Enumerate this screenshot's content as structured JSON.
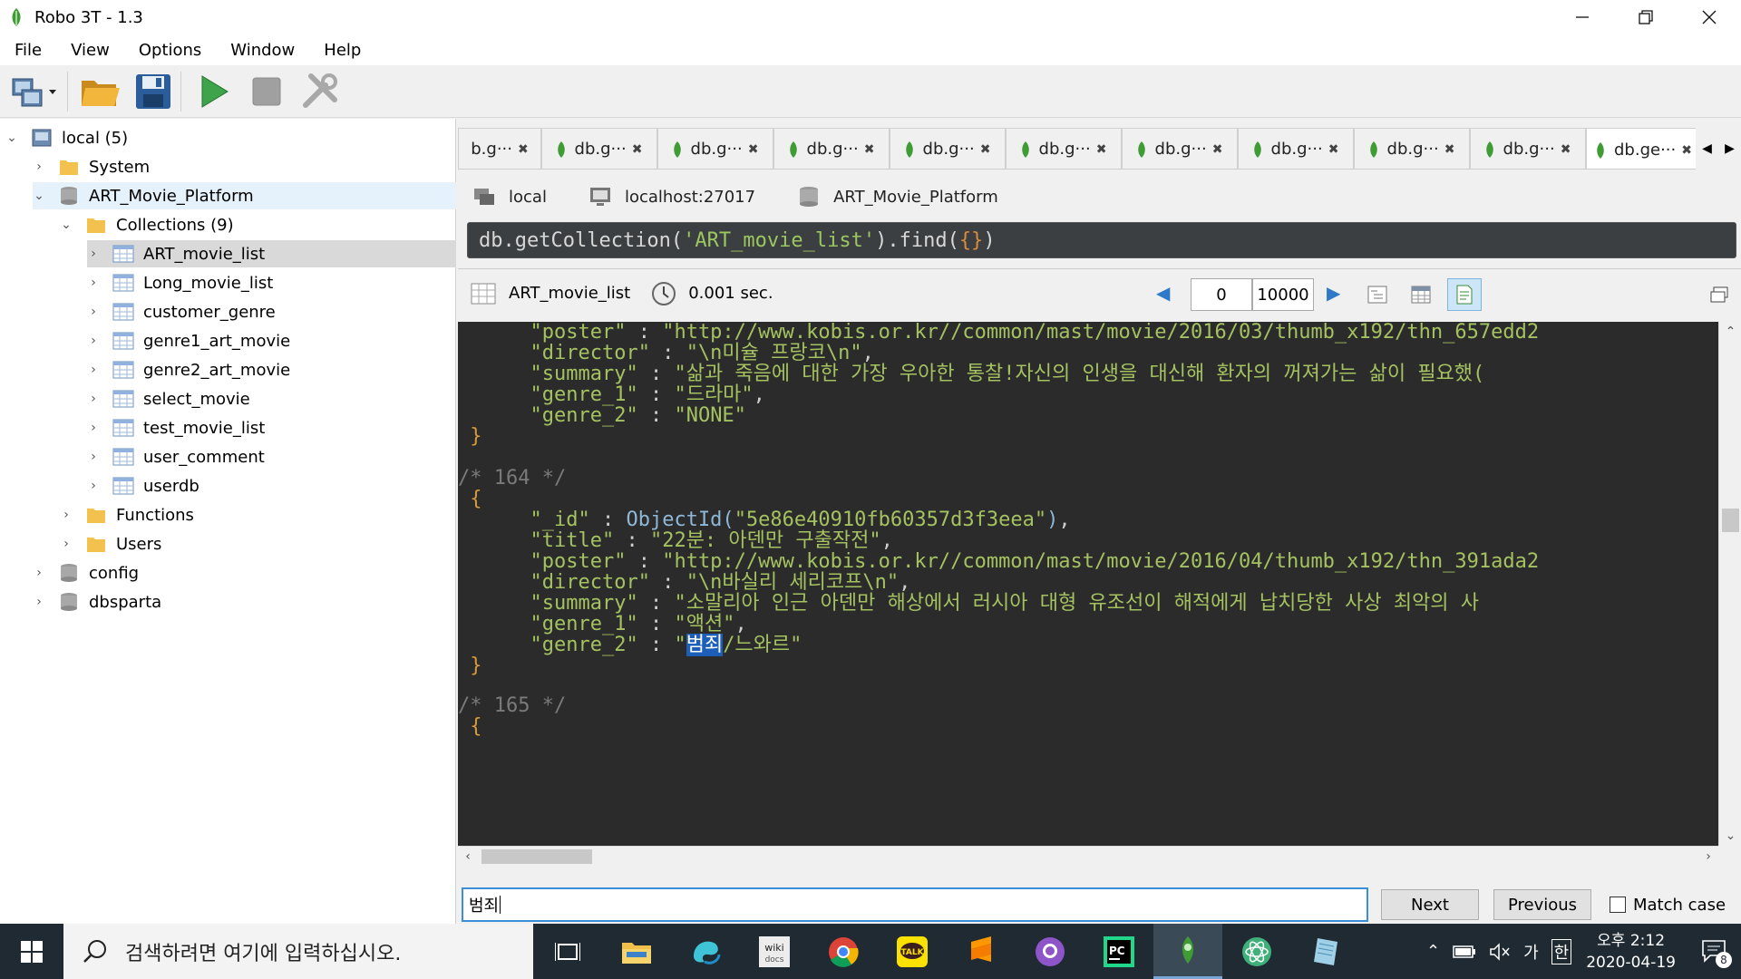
{
  "window": {
    "title": "Robo 3T - 1.3"
  },
  "menu": [
    "File",
    "View",
    "Options",
    "Window",
    "Help"
  ],
  "tree": {
    "root": "local (5)",
    "system": "System",
    "db": "ART_Movie_Platform",
    "collections_label": "Collections (9)",
    "collections": [
      "ART_movie_list",
      "Long_movie_list",
      "customer_genre",
      "genre1_art_movie",
      "genre2_art_movie",
      "select_movie",
      "test_movie_list",
      "user_comment",
      "userdb"
    ],
    "functions": "Functions",
    "users": "Users",
    "other_dbs": [
      "config",
      "dbsparta"
    ]
  },
  "tabs": {
    "first_partial": "b.g···",
    "items": [
      "db.g···",
      "db.g···",
      "db.g···",
      "db.g···",
      "db.g···",
      "db.g···",
      "db.g···",
      "db.g···",
      "db.g···"
    ],
    "active": "db.ge···"
  },
  "connection": {
    "server": "local",
    "host": "localhost:27017",
    "database": "ART_Movie_Platform"
  },
  "query": {
    "prefix": "db.getCollection(",
    "collection": "'ART_movie_list'",
    "suffix": ").find(",
    "braces": "{}",
    "end": ")"
  },
  "result": {
    "collection": "ART_movie_list",
    "time": "0.001 sec.",
    "skip": "0",
    "limit": "10000"
  },
  "code": {
    "rec163": {
      "poster": "\"http://www.kobis.or.kr//common/mast/movie/2016/03/thumb_x192/thn_657edd2",
      "director": "\"\\n미슐 프랑코\\n\"",
      "summary": "\"삶과 죽음에 대한 가장 우아한 통찰!자신의 인생을 대신해 환자의 꺼져가는 삶이 필요했(",
      "genre_1": "\"드라마\"",
      "genre_2": "\"NONE\""
    },
    "comment164": "/* 164 */",
    "rec164": {
      "id_fn": "ObjectId(",
      "id_val": "\"5e86e40910fb60357d3f3eea\"",
      "title": "\"22분: 아덴만 구출작전\"",
      "poster": "\"http://www.kobis.or.kr//common/mast/movie/2016/04/thumb_x192/thn_391ada2",
      "director": "\"\\n바실리 세리코프\\n\"",
      "summary": "\"소말리아 인근 아덴만 해상에서 러시아 대형 유조선이 해적에게 납치당한 사상 최악의 사",
      "genre_1": "\"액션\"",
      "genre_2_match": "범죄",
      "genre_2_rest": "/느와르\""
    },
    "comment165": "/* 165 */",
    "keys": {
      "id": "\"_id\"",
      "title": "\"title\"",
      "poster": "\"poster\"",
      "director": "\"director\"",
      "summary": "\"summary\"",
      "genre_1": "\"genre_1\"",
      "genre_2": "\"genre_2\""
    }
  },
  "find": {
    "value": "범죄",
    "next": "Next",
    "previous": "Previous",
    "match_case": "Match case"
  },
  "taskbar": {
    "search_placeholder": "검색하려면 여기에 입력하십시오.",
    "ime": "가",
    "ime2": "한",
    "time": "오후 2:12",
    "date": "2020-04-19",
    "notifications": "8"
  }
}
